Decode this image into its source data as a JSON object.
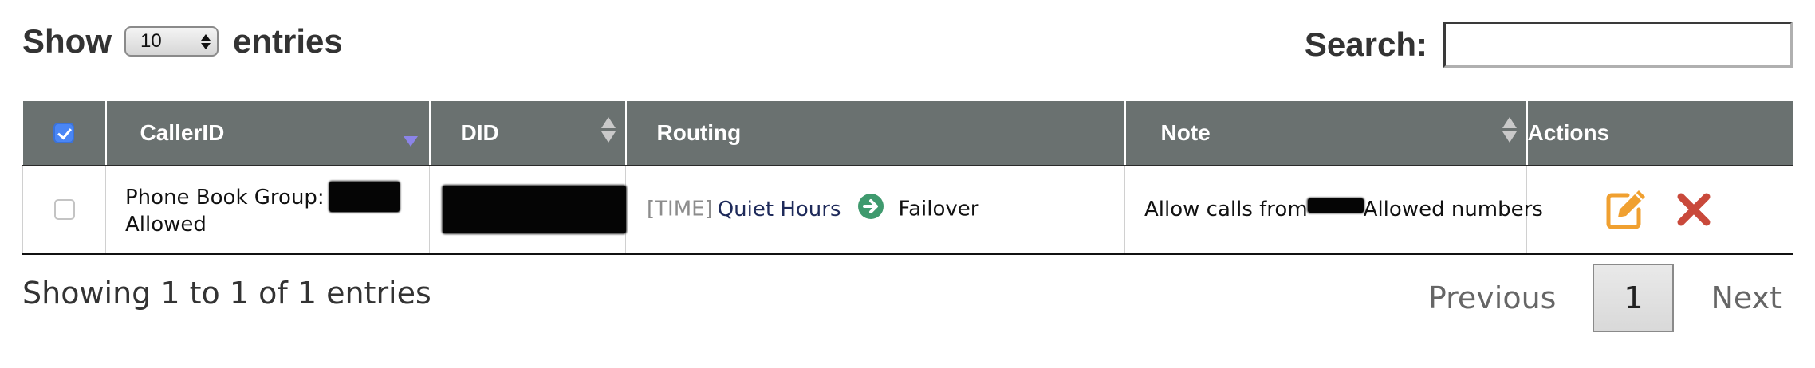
{
  "length_control": {
    "show_label": "Show",
    "selected_value": "10",
    "entries_label": "entries"
  },
  "search": {
    "label": "Search:",
    "value": "",
    "placeholder": ""
  },
  "table": {
    "columns": [
      {
        "label": "CallerID",
        "sort": "descending"
      },
      {
        "label": "DID",
        "sort": "sortable"
      },
      {
        "label": "Routing",
        "sort": "none"
      },
      {
        "label": "Note",
        "sort": "sortable"
      },
      {
        "label": "Actions",
        "sort": "none"
      }
    ],
    "select_all_checked": true,
    "rows": [
      {
        "checked": false,
        "callerid_prefix": "Phone Book Group:",
        "callerid_suffix": "Allowed",
        "routing_tag": "[TIME]",
        "routing_link": "Quiet Hours",
        "routing_target": "Failover",
        "note_prefix": "Allow calls from",
        "note_suffix": "Allowed numbers"
      }
    ]
  },
  "footer": {
    "info": "Showing 1 to 1 of 1 entries",
    "previous": "Previous",
    "current_page": "1",
    "next": "Next"
  },
  "icons": {
    "routing_arrow": "arrow-right-circle-icon",
    "edit": "edit-pencil-icon",
    "delete": "delete-x-icon"
  },
  "colors": {
    "header_bg": "#6a7170",
    "arrow_green": "#3f9a6e",
    "edit_orange": "#f0a030",
    "delete_red": "#c9493b",
    "checkbox_blue": "#4a86f5"
  }
}
